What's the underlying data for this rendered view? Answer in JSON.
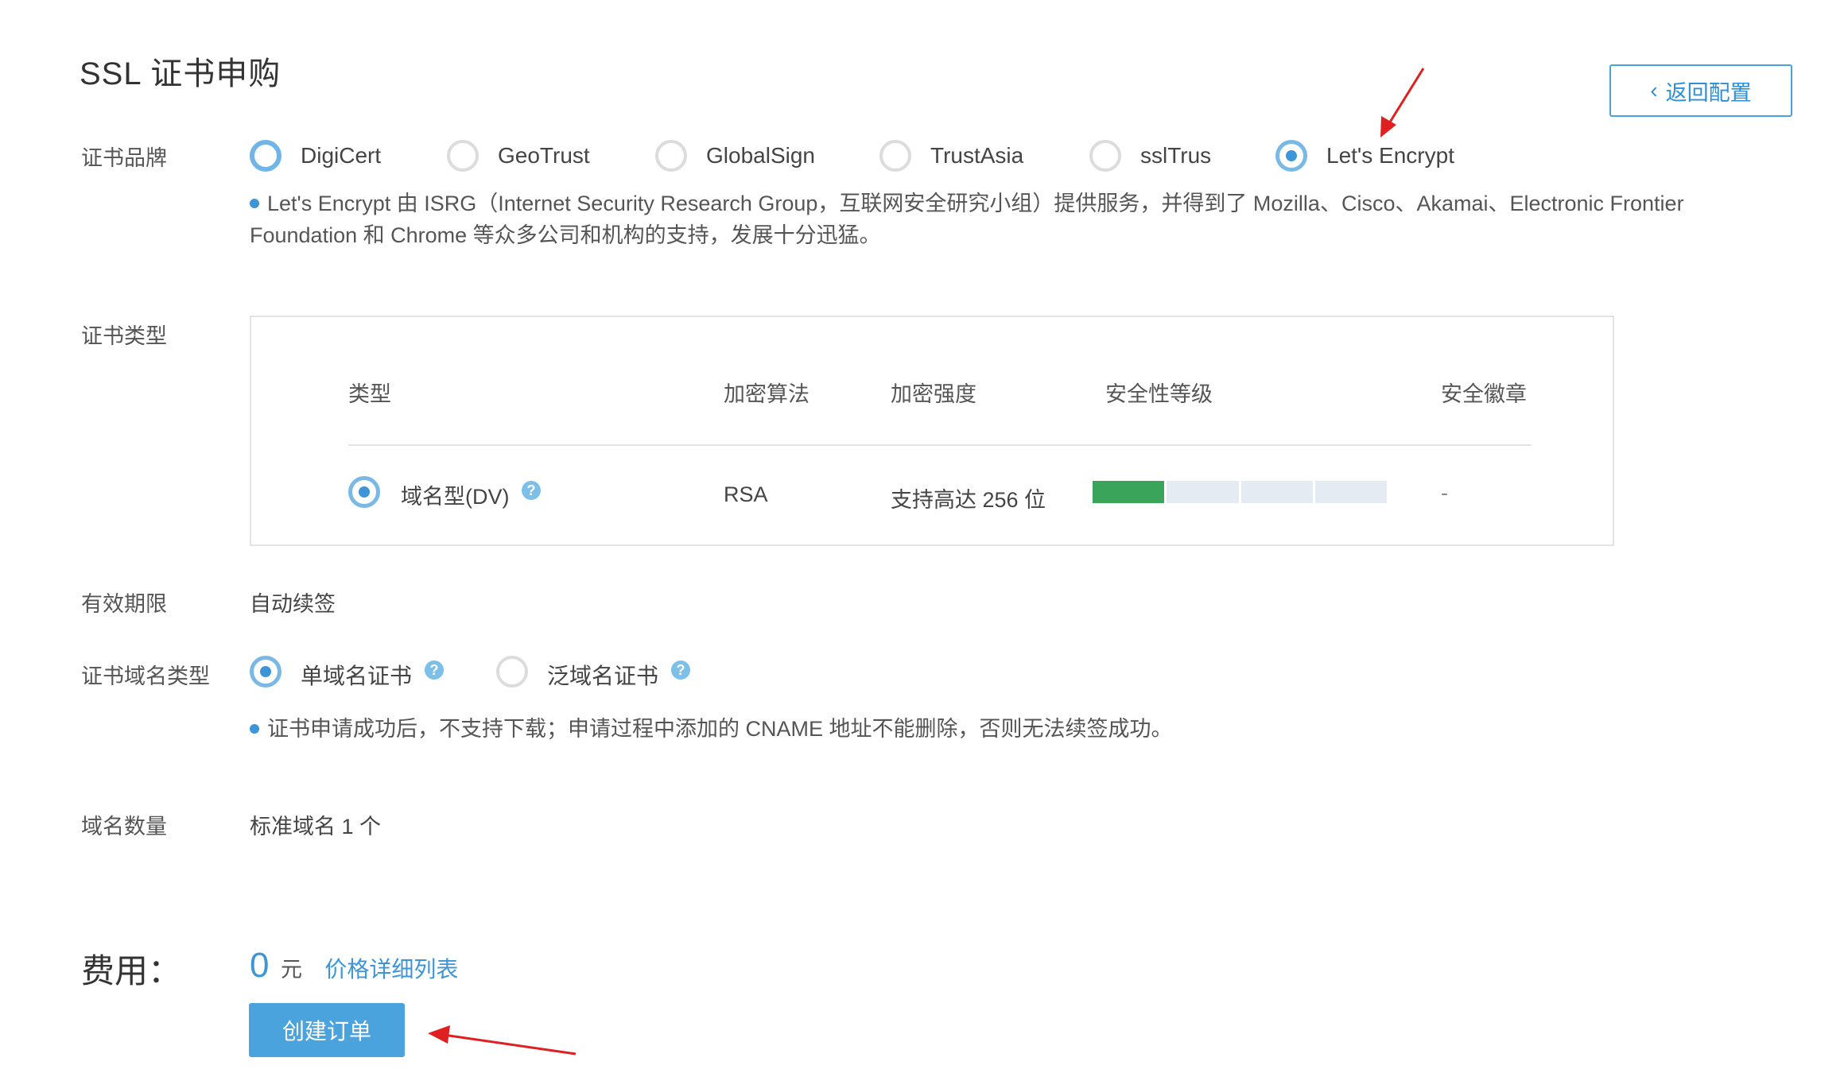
{
  "page": {
    "title": "SSL 证书申购"
  },
  "back_button": {
    "label": "返回配置",
    "icon": "chevron-left-icon"
  },
  "brand": {
    "label": "证书品牌",
    "options": [
      "DigiCert",
      "GeoTrust",
      "GlobalSign",
      "TrustAsia",
      "sslTrus",
      "Let's Encrypt"
    ],
    "selected": "Let's Encrypt",
    "note": "Let's Encrypt 由 ISRG（Internet Security Research Group，互联网安全研究小组）提供服务，并得到了 Mozilla、Cisco、Akamai、Electronic Frontier Foundation 和 Chrome 等众多公司和机构的支持，发展十分迅猛。"
  },
  "cert_type": {
    "label": "证书类型",
    "headers": [
      "类型",
      "加密算法",
      "加密强度",
      "安全性等级",
      "安全徽章"
    ],
    "row": {
      "type": "域名型(DV)",
      "algorithm": "RSA",
      "strength": "支持高达 256 位",
      "security_level": 0.25,
      "badge": "-"
    }
  },
  "validity": {
    "label": "有效期限",
    "value": "自动续签"
  },
  "domain_type": {
    "label": "证书域名类型",
    "options": [
      "单域名证书",
      "泛域名证书"
    ],
    "selected": "单域名证书",
    "note": "证书申请成功后，不支持下载；申请过程中添加的 CNAME 地址不能删除，否则无法续签成功。"
  },
  "domain_count": {
    "label": "域名数量",
    "value": "标准域名 1 个"
  },
  "fee": {
    "label": "费用：",
    "amount": "0",
    "unit": "元",
    "link": "价格详细列表"
  },
  "create_button": {
    "label": "创建订单"
  },
  "colors": {
    "accent": "#3d95d8",
    "security_fill": "#3aa55a",
    "arrow": "#e02020"
  }
}
